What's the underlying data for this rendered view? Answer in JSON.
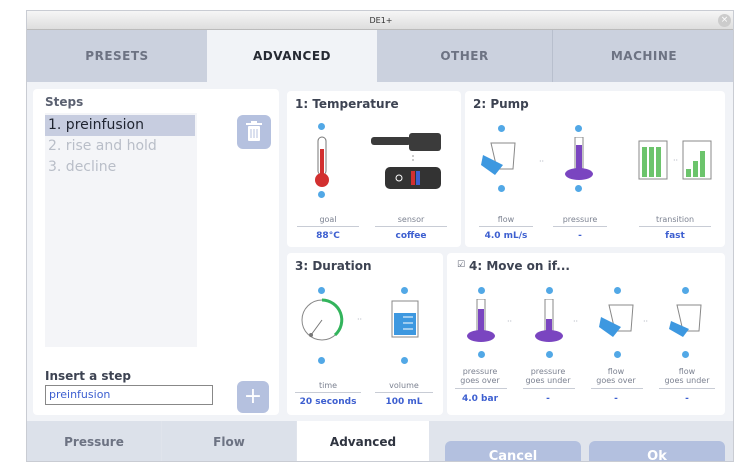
{
  "window": {
    "title": "DE1+"
  },
  "tabs": [
    "PRESETS",
    "ADVANCED",
    "OTHER",
    "MACHINE"
  ],
  "steps": {
    "heading": "Steps",
    "items": [
      "1. preinfusion",
      "2. rise and hold",
      "3. decline"
    ],
    "insert_label": "Insert a step",
    "insert_value": "preinfusion"
  },
  "temperature": {
    "title": "1: Temperature",
    "goal_label": "goal",
    "sensor_label": "sensor",
    "goal_value": "88°C",
    "sensor_value": "coffee"
  },
  "pump": {
    "title": "2: Pump",
    "flow_label": "flow",
    "pressure_label": "pressure",
    "transition_label": "transition",
    "flow_value": "4.0 mL/s",
    "pressure_value": "-",
    "transition_value": "fast"
  },
  "duration": {
    "title": "3: Duration",
    "time_label": "time",
    "volume_label": "volume",
    "time_value": "20 seconds",
    "volume_value": "100 mL"
  },
  "moveon": {
    "title": "4: Move on if...",
    "checkbox": "☑",
    "items": [
      {
        "label1": "pressure",
        "label2": "goes over",
        "value": "4.0 bar"
      },
      {
        "label1": "pressure",
        "label2": "goes under",
        "value": "-"
      },
      {
        "label1": "flow",
        "label2": "goes over",
        "value": "-"
      },
      {
        "label1": "flow",
        "label2": "goes under",
        "value": "-"
      }
    ]
  },
  "bottom_tabs": [
    "Pressure",
    "Flow",
    "Advanced"
  ],
  "buttons": {
    "cancel": "Cancel",
    "ok": "Ok"
  },
  "icons": {
    "trash": "trash-icon",
    "add": "plus-icon",
    "close": "close-icon"
  },
  "colors": {
    "accent": "#3d5fd0",
    "button": "#b3c0df",
    "selection": "#c7cde0",
    "dot": "#52a8e6",
    "purple": "#7a45c0"
  }
}
